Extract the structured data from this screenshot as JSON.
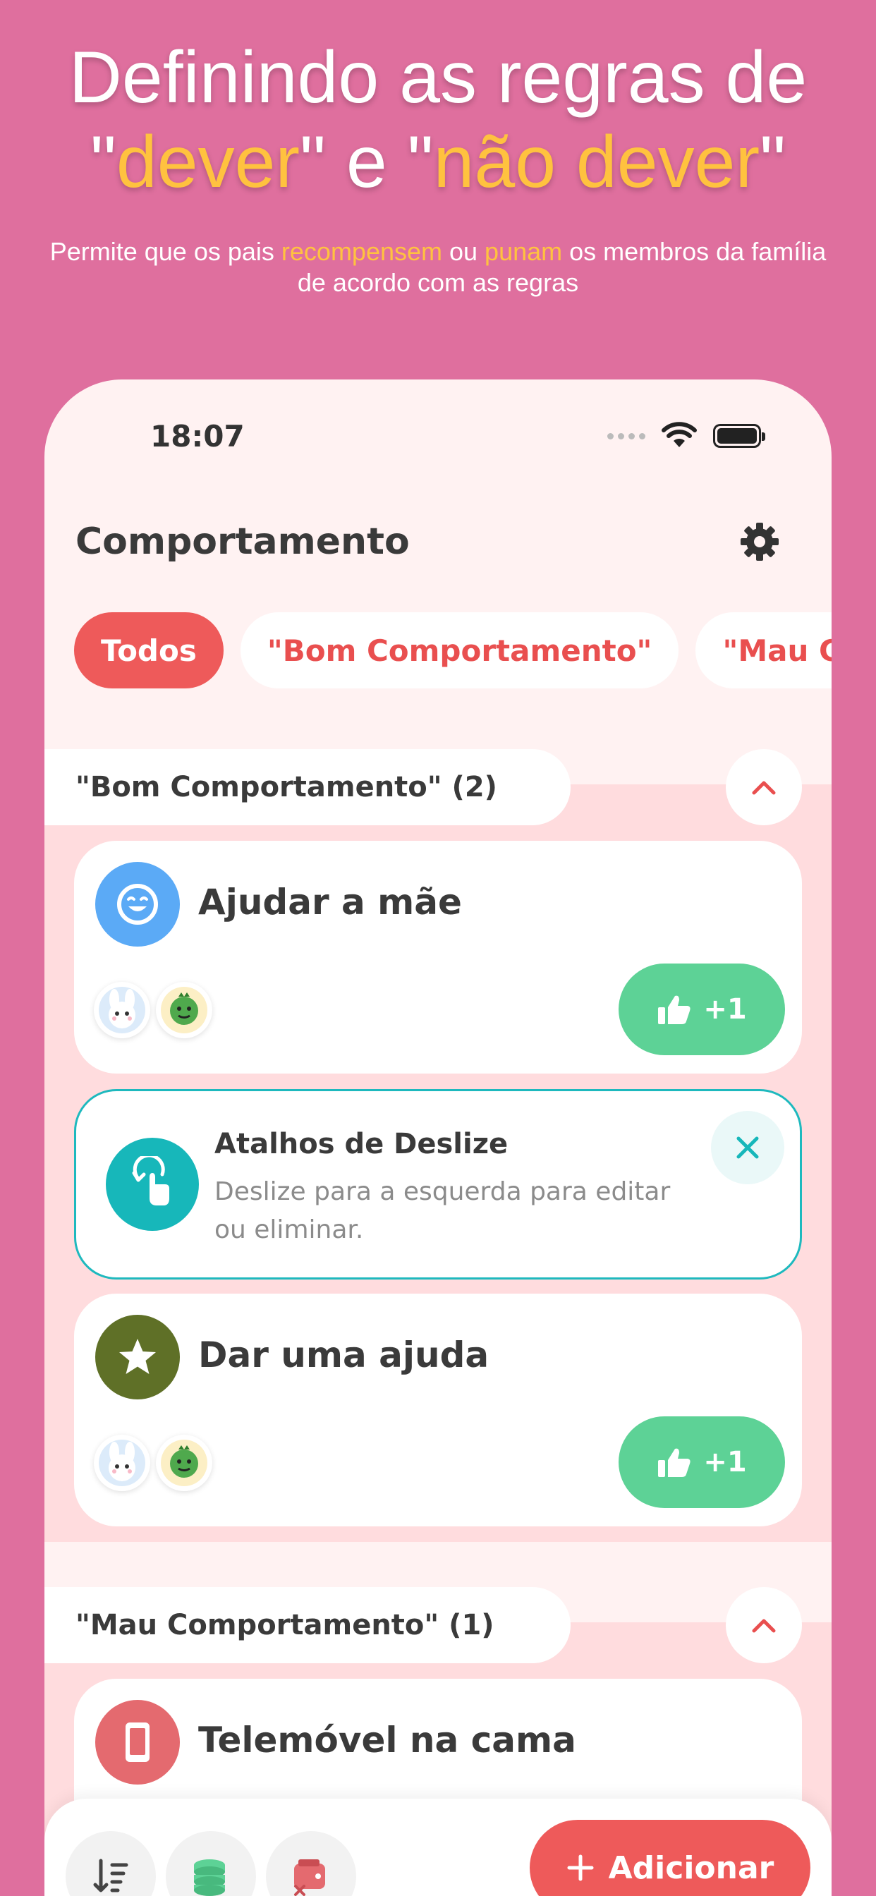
{
  "promo": {
    "headline_line1": "Definindo as regras de",
    "q1": "\"",
    "hl1": "dever",
    "mid": "\" e \"",
    "hl2": "não dever",
    "q2": "\"",
    "sub_a": "Permite que os pais ",
    "sub_hl1": "recompensem",
    "sub_b": " ou ",
    "sub_hl2": "punam",
    "sub_c": " os membros da família de acordo com as regras",
    "accent": "#FFC23F",
    "background": "#DF6F9E"
  },
  "status": {
    "time": "18:07"
  },
  "app": {
    "title": "Comportamento",
    "tabs": [
      "Todos",
      "\"Bom Comportamento\"",
      "\"Mau Co"
    ]
  },
  "sections": {
    "good": {
      "header": "\"Bom Comportamento\" (2)",
      "items": [
        {
          "title": "Ajudar a mãe",
          "icon": "smiley-icon",
          "icon_color": "#5BAAF6",
          "vote": "+1"
        },
        {
          "title": "Dar uma ajuda",
          "icon": "star-icon",
          "icon_color": "#5F7027",
          "vote": "+1"
        }
      ]
    },
    "tip": {
      "title": "Atalhos de Deslize",
      "text": "Deslize para a esquerda para editar ou eliminar."
    },
    "bad": {
      "header": "\"Mau Comportamento\" (1)",
      "items": [
        {
          "title": "Telemóvel na cama",
          "icon": "phone-icon",
          "icon_color": "#E46A6F"
        }
      ]
    }
  },
  "bottom": {
    "add_label": "Adicionar"
  },
  "colors": {
    "primary": "#EE5A5A",
    "positive": "#5DD296",
    "teal": "#17B7BA"
  }
}
